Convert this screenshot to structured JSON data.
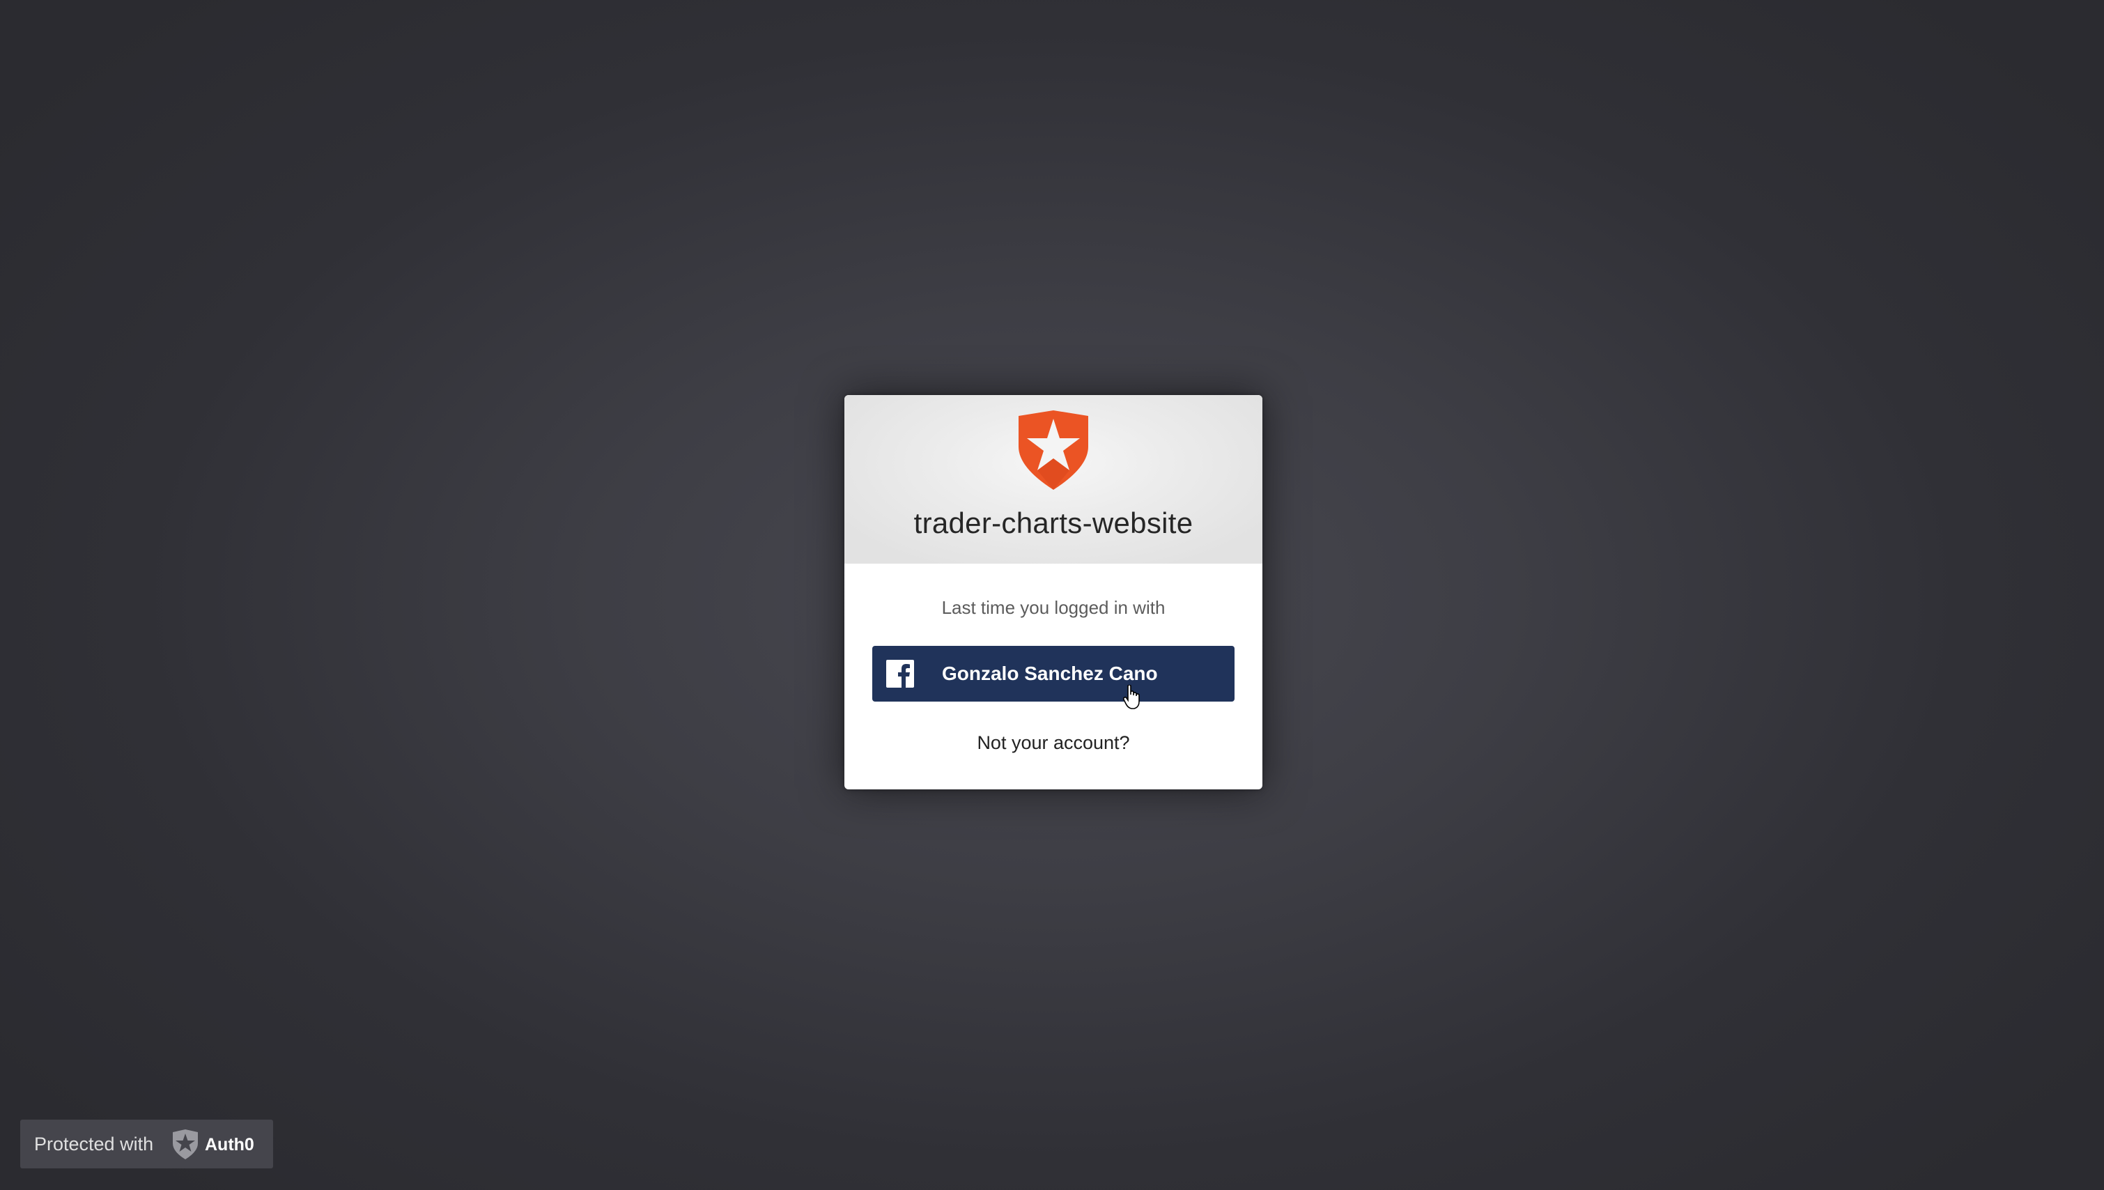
{
  "app": {
    "title": "trader-charts-website",
    "logo_icon": "auth0-shield-star-icon",
    "brand_color": "#eb5424"
  },
  "lock": {
    "last_login_text": "Last time you logged in with",
    "social_button": {
      "provider_icon": "facebook-icon",
      "label": "Gonzalo Sanchez Cano",
      "color": "#20335a"
    },
    "not_your_account_link": "Not your account?"
  },
  "footer_badge": {
    "protected_text": "Protected with",
    "brand_icon": "auth0-logo-icon",
    "brand_name": "Auth0"
  }
}
